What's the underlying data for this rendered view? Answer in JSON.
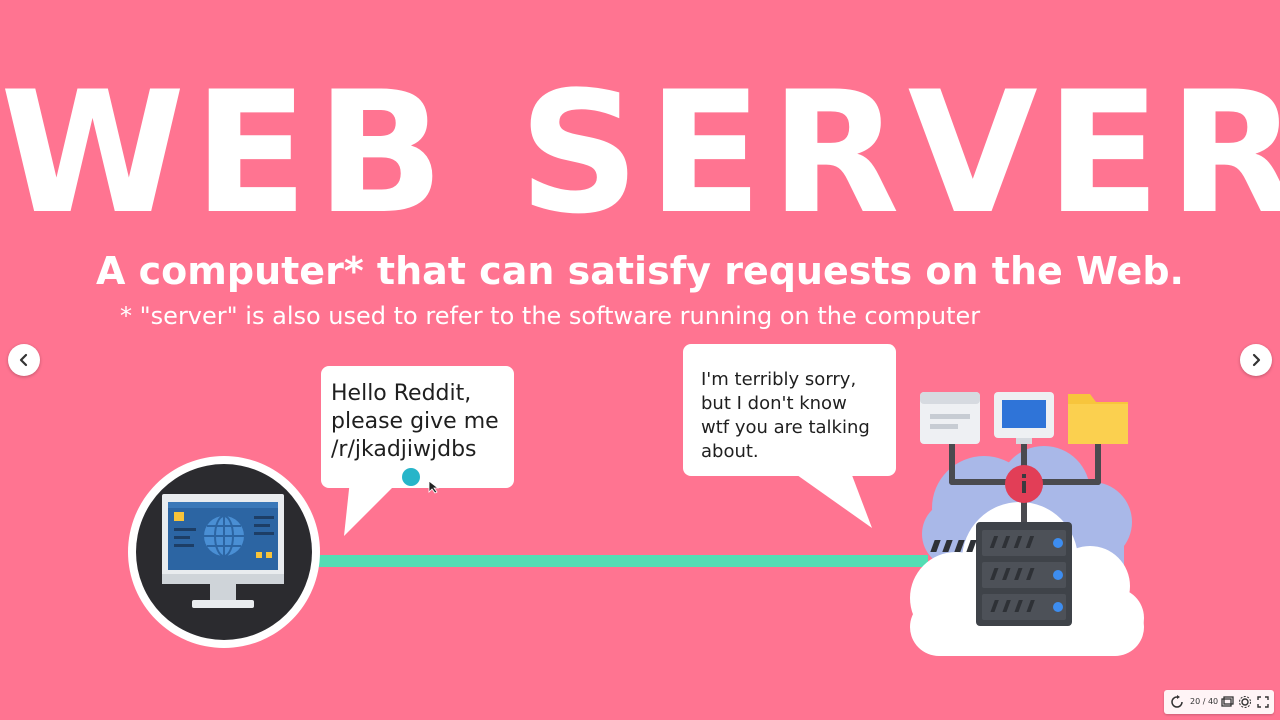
{
  "slide": {
    "title": "WEB SERVER",
    "subtitle": "A computer* that can satisfy requests on the Web.",
    "footnote": "* \"server\" is also used to refer to the software running on the computer",
    "background_color": "#ff7491"
  },
  "client_bubble": {
    "text": "Hello Reddit,\nplease give me\n/r/jkadjiwjdbs"
  },
  "server_bubble": {
    "text": "I'm terribly sorry,\nbut I don't know\nwtf you are talking\nabout."
  },
  "connection": {
    "color": "#53ddb4"
  },
  "navigation": {
    "prev_icon": "chevron-left-icon",
    "next_icon": "chevron-right-icon"
  },
  "player": {
    "page_indicator": "20 / 40",
    "replay_icon": "replay-icon",
    "slides_icon": "slides-icon",
    "settings_icon": "settings-icon",
    "fullscreen_icon": "fullscreen-icon"
  },
  "icons": {
    "client": "desktop-computer-icon",
    "server": "server-rack-icon",
    "cloud": "cloud-icon",
    "folder": "folder-icon",
    "monitor": "monitor-icon",
    "window": "browser-window-icon"
  }
}
